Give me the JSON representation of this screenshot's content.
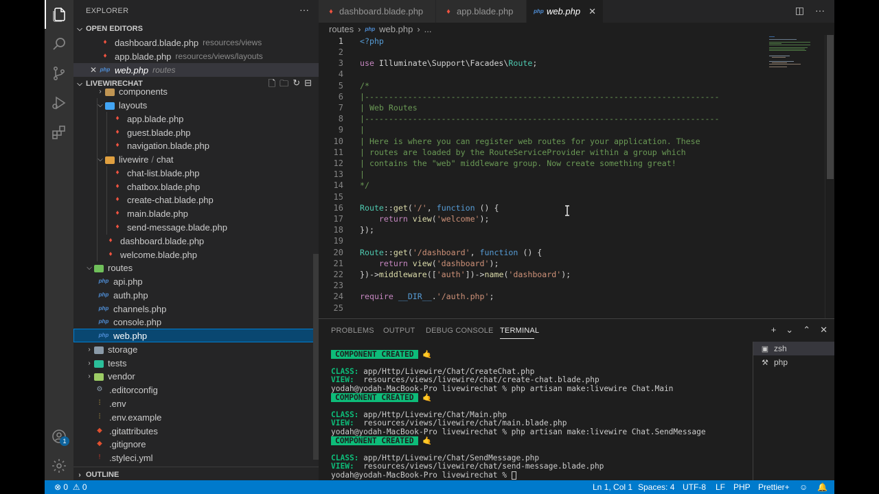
{
  "sidebar": {
    "title": "EXPLORER",
    "open_editors_label": "OPEN EDITORS",
    "open_editors": [
      {
        "name": "dashboard.blade.php",
        "path": "resources/views"
      },
      {
        "name": "app.blade.php",
        "path": "resources/views/layouts"
      },
      {
        "name": "web.php",
        "path": "routes"
      }
    ],
    "project_label": "LIVEWIRECHAT",
    "tree": [
      {
        "label": "components",
        "kind": "folder"
      },
      {
        "label": "layouts",
        "kind": "folder-open"
      },
      {
        "label": "app.blade.php",
        "kind": "blade"
      },
      {
        "label": "guest.blade.php",
        "kind": "blade"
      },
      {
        "label": "navigation.blade.php",
        "kind": "blade"
      },
      {
        "label": "livewire",
        "label2": "chat",
        "kind": "folder-open"
      },
      {
        "label": "chat-list.blade.php",
        "kind": "blade"
      },
      {
        "label": "chatbox.blade.php",
        "kind": "blade"
      },
      {
        "label": "create-chat.blade.php",
        "kind": "blade"
      },
      {
        "label": "main.blade.php",
        "kind": "blade"
      },
      {
        "label": "send-message.blade.php",
        "kind": "blade"
      },
      {
        "label": "dashboard.blade.php",
        "kind": "blade"
      },
      {
        "label": "welcome.blade.php",
        "kind": "blade"
      },
      {
        "label": "routes",
        "kind": "folder-open"
      },
      {
        "label": "api.php",
        "kind": "php"
      },
      {
        "label": "auth.php",
        "kind": "php"
      },
      {
        "label": "channels.php",
        "kind": "php"
      },
      {
        "label": "console.php",
        "kind": "php"
      },
      {
        "label": "web.php",
        "kind": "php"
      },
      {
        "label": "storage",
        "kind": "folder"
      },
      {
        "label": "tests",
        "kind": "folder"
      },
      {
        "label": "vendor",
        "kind": "folder"
      },
      {
        "label": ".editorconfig",
        "kind": "gear"
      },
      {
        "label": ".env",
        "kind": "env"
      },
      {
        "label": ".env.example",
        "kind": "env"
      },
      {
        "label": ".gitattributes",
        "kind": "git"
      },
      {
        "label": ".gitignore",
        "kind": "git"
      },
      {
        "label": ".styleci.yml",
        "kind": "yml"
      }
    ],
    "outline_label": "OUTLINE"
  },
  "tabs": [
    {
      "label": "dashboard.blade.php"
    },
    {
      "label": "app.blade.php"
    },
    {
      "label": "web.php"
    }
  ],
  "breadcrumb": {
    "folder": "routes",
    "file": "web.php",
    "more": "..."
  },
  "code": {
    "line_numbers": [
      "1",
      "2",
      "3",
      "4",
      "5",
      "6",
      "7",
      "8",
      "9",
      "10",
      "11",
      "12",
      "13",
      "14",
      "15",
      "16",
      "17",
      "18",
      "19",
      "20",
      "21",
      "22",
      "23",
      "24",
      "25"
    ],
    "comment_rule": "|--------------------------------------------------------------------------",
    "comment_title": "| Web Routes",
    "comment_body": [
      "| Here is where you can register web routes for your application. These",
      "| routes are loaded by the RouteServiceProvider within a group which",
      "| contains the \"web\" middleware group. Now create something great!"
    ]
  },
  "panel": {
    "tabs": [
      "PROBLEMS",
      "OUTPUT",
      "DEBUG CONSOLE",
      "TERMINAL"
    ],
    "badge": "COMPONENT CREATED",
    "badge_emoji": "🤙",
    "class_label": "CLASS:",
    "view_label": "VIEW:",
    "blocks": [
      {
        "class": "app/Http/Livewire/Chat/CreateChat.php",
        "view": "resources/views/livewire/chat/create-chat.blade.php",
        "prompt": "yodah@yodah-MacBook-Pro livewirechat % php artisan make:livewire Chat.Main"
      },
      {
        "class": "app/Http/Livewire/Chat/Main.php",
        "view": "resources/views/livewire/chat/main.blade.php",
        "prompt": "yodah@yodah-MacBook-Pro livewirechat % php artisan make:livewire Chat.SendMessage"
      },
      {
        "class": "app/Http/Livewire/Chat/SendMessage.php",
        "view": "resources/views/livewire/chat/send-message.blade.php",
        "prompt": "yodah@yodah-MacBook-Pro livewirechat % "
      }
    ],
    "terminals": [
      "zsh",
      "php"
    ]
  },
  "status": {
    "errors": "0",
    "warnings": "0",
    "position": "Ln 1, Col 1",
    "spaces": "Spaces: 4",
    "encoding": "UTF-8",
    "eol": "LF",
    "language": "PHP",
    "formatter": "Prettier+"
  }
}
